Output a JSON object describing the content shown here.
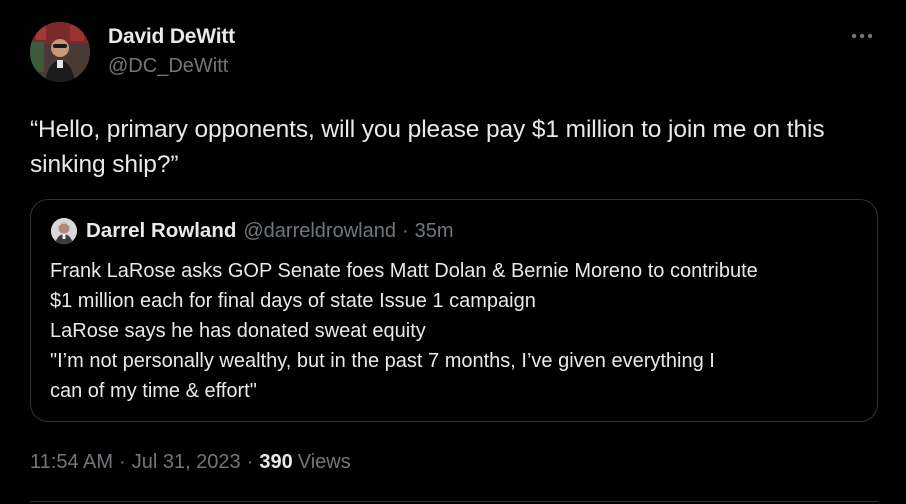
{
  "author": {
    "name": "David DeWitt",
    "handle": "@DC_DeWitt"
  },
  "tweet": {
    "text": "“Hello, primary opponents, will you please pay $1 million to join me on this sinking ship?”"
  },
  "quote": {
    "author_name": "Darrel Rowland",
    "author_handle": "@darreldrowland",
    "separator": "·",
    "time": "35m",
    "lines": [
      "Frank LaRose asks GOP Senate foes Matt Dolan & Bernie Moreno to contribute",
      "$1 million each for final days of state Issue 1 campaign",
      "LaRose says he has donated sweat equity",
      "\"I’m not personally wealthy, but in the past 7 months, I’ve given everything I",
      "can of my time & effort\""
    ]
  },
  "meta": {
    "time": "11:54 AM",
    "date": "Jul 31, 2023",
    "separator": "·",
    "views_count": "390",
    "views_label": "Views"
  },
  "icons": {
    "more": "more-horizontal-icon"
  },
  "colors": {
    "background": "#000000",
    "text_primary": "#e7e9ea",
    "text_secondary": "#71767b",
    "border": "#2f3336"
  }
}
